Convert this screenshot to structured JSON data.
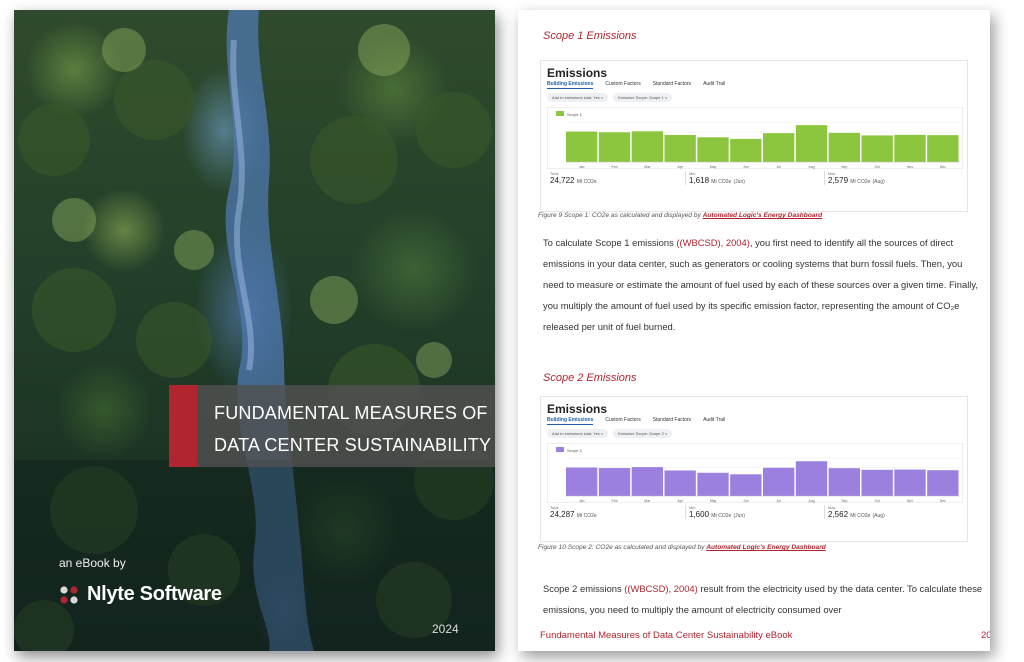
{
  "cover": {
    "title_line1": "FUNDAMENTAL MEASURES OF",
    "title_line2": "DATA CENTER SUSTAINABILITY",
    "ebook_by": "an eBook by",
    "brand": "Nlyte Software",
    "year": "2024",
    "accent_color": "#b0252f"
  },
  "page": {
    "number": "20",
    "footer": "Fundamental Measures of Data Center Sustainability eBook",
    "scope1": {
      "heading": "Scope 1 Emissions",
      "caption_prefix": "Figure 9 Scope 1: CO2e as calculated and displayed by ",
      "caption_link": "Automated Logic's Energy Dashboard",
      "paragraph_pre": "To calculate Scope 1 emissions ",
      "paragraph_cite": "((WBCSD), 2004)",
      "paragraph_post": ", you first need to identify all the sources of direct emissions in your data center, such as generators or cooling systems that burn fossil fuels. Then, you need to measure or estimate the amount of fuel used by each of these sources over a given time. Finally, you multiply the amount of fuel used by its specific emission factor, representing the amount of CO₂e released per unit of fuel burned.",
      "dashboard": {
        "title": "Emissions",
        "tabs": [
          "Building Emissions",
          "Custom Factors",
          "Standard Factors",
          "Audit Trail"
        ],
        "filters": [
          "Add to emissions total: Yes ×",
          "Emission Scope: Scope 1 ×"
        ],
        "legend": "Scope 1",
        "stats": [
          {
            "label": "Total",
            "value": "24,722",
            "unit": "Mt CO2e",
            "note": ""
          },
          {
            "label": "Min",
            "value": "1,618",
            "unit": "Mt CO2e",
            "note": "(Jun)"
          },
          {
            "label": "Max",
            "value": "2,579",
            "unit": "Mt CO2e",
            "note": "(Aug)"
          }
        ]
      }
    },
    "scope2": {
      "heading": "Scope 2 Emissions",
      "caption_prefix": "Figure 10 Scope 2: CO2e as calculated and displayed by ",
      "caption_link": "Automated Logic's Energy Dashboard",
      "paragraph_pre": "Scope 2 emissions ",
      "paragraph_cite": "((WBCSD), 2004)",
      "paragraph_post": " result from the electricity used by the data center. To calculate these emissions, you need to multiply the amount of electricity consumed over",
      "dashboard": {
        "title": "Emissions",
        "tabs": [
          "Building Emissions",
          "Custom Factors",
          "Standard Factors",
          "Audit Trail"
        ],
        "filters": [
          "Add to emissions total: Yes ×",
          "Emission Scope: Scope 2 ×"
        ],
        "legend": "Scope 2",
        "stats": [
          {
            "label": "Total",
            "value": "24,287",
            "unit": "Mt CO2e",
            "note": ""
          },
          {
            "label": "Min",
            "value": "1,600",
            "unit": "Mt CO2e",
            "note": "(Jun)"
          },
          {
            "label": "Max",
            "value": "2,562",
            "unit": "Mt CO2e",
            "note": "(Aug)"
          }
        ]
      }
    }
  },
  "chart_data": [
    {
      "type": "bar",
      "categories": [
        "Jan",
        "Feb",
        "Mar",
        "Apr",
        "May",
        "Jun",
        "Jul",
        "Aug",
        "Sep",
        "Oct",
        "Nov",
        "Dec"
      ],
      "series": [
        {
          "name": "Scope 1",
          "values": [
            2130,
            2080,
            2150,
            1890,
            1730,
            1618,
            2020,
            2579,
            2040,
            1860,
            1900,
            1880
          ],
          "color": "#8cc63f"
        }
      ],
      "ylim": [
        0,
        2800
      ]
    },
    {
      "type": "bar",
      "categories": [
        "Jan",
        "Feb",
        "Mar",
        "Apr",
        "May",
        "Jun",
        "Jul",
        "Aug",
        "Sep",
        "Oct",
        "Nov",
        "Dec"
      ],
      "series": [
        {
          "name": "Scope 2",
          "values": [
            2100,
            2060,
            2130,
            1880,
            1710,
            1600,
            2080,
            2562,
            2050,
            1930,
            1950,
            1900
          ],
          "color": "#9b80e0"
        }
      ],
      "ylim": [
        0,
        2800
      ]
    }
  ]
}
